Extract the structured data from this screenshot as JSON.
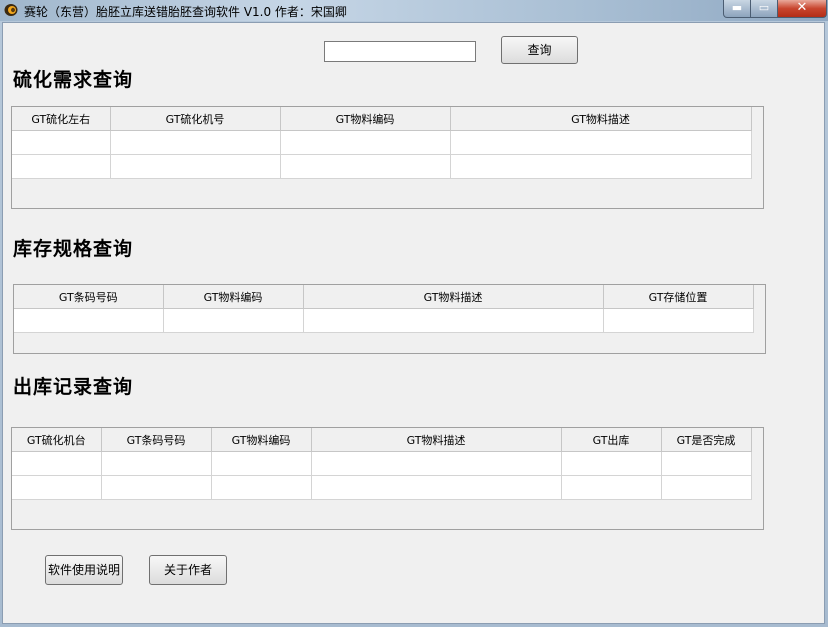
{
  "window": {
    "title": "赛轮（东营）胎胚立库送错胎胚查询软件 V1.0   作者：宋国卿",
    "controls": {
      "minimize": "▬",
      "maximize": "▭",
      "close": "✕"
    }
  },
  "search": {
    "value": "",
    "button_label": "查询"
  },
  "sections": {
    "vulcanize": {
      "title": "硫化需求查询",
      "columns": [
        "GT硫化左右",
        "GT硫化机号",
        "GT物料编码",
        "GT物料描述"
      ],
      "rows": [
        [
          "",
          "",
          "",
          ""
        ],
        [
          "",
          "",
          "",
          ""
        ]
      ]
    },
    "stock": {
      "title": "库存规格查询",
      "columns": [
        "GT条码号码",
        "GT物料编码",
        "GT物料描述",
        "GT存储位置"
      ],
      "rows": [
        [
          "",
          "",
          "",
          ""
        ]
      ]
    },
    "outbound": {
      "title": "出库记录查询",
      "columns": [
        "GT硫化机台",
        "GT条码号码",
        "GT物料编码",
        "GT物料描述",
        "GT出库",
        "GT是否完成"
      ],
      "rows": [
        [
          "",
          "",
          "",
          "",
          "",
          ""
        ],
        [
          "",
          "",
          "",
          "",
          "",
          ""
        ]
      ]
    }
  },
  "footer": {
    "help_button": "软件使用说明",
    "about_button": "关于作者"
  }
}
